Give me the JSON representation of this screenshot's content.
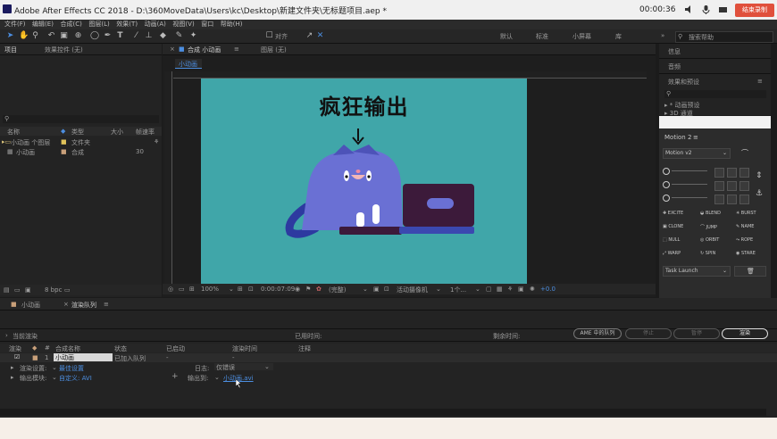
{
  "window": {
    "title": "Adobe After Effects CC 2018 - D:\\360MoveData\\Users\\kc\\Desktop\\新建文件夹\\无标题项目.aep *",
    "recording_time": "00:00:36",
    "recording_button": "结束录制"
  },
  "menu": [
    "文件(F)",
    "编辑(E)",
    "合成(C)",
    "图层(L)",
    "效果(T)",
    "动画(A)",
    "视图(V)",
    "窗口",
    "帮助(H)"
  ],
  "toolbar": {
    "snap_label": "对齐",
    "workspaces": [
      "默认",
      "标准",
      "小屏幕",
      "库"
    ],
    "search_placeholder": "搜索帮助"
  },
  "project_panel": {
    "tab_project": "项目",
    "tab_effects": "效果控件 (无)",
    "columns": [
      "名称",
      "类型",
      "大小",
      "帧速率"
    ],
    "items": [
      {
        "name": "小动画 个图层",
        "type": "文件夹",
        "size": ""
      },
      {
        "name": "小动画",
        "type": "合成",
        "size": "30"
      }
    ],
    "bpc": "8 bpc"
  },
  "composition_panel": {
    "tab_label": "合成 小动画",
    "layer_tab": "图层 (无)",
    "breadcrumb": "小动画",
    "canvas_title": "疯狂输出",
    "zoom": "100%",
    "timecode": "0:00:07:09",
    "resolution": "(完整)",
    "camera": "活动摄像机",
    "views": "1个...",
    "exposure": "+0.0"
  },
  "right_panels": {
    "info": "信息",
    "audio": "音频",
    "effects_presets": "效果和预设",
    "presets_item1": "▸ * 动画预设",
    "presets_item2": "▸ 3D 通道"
  },
  "motion_panel": {
    "title": "Motion 2",
    "version": "Motion v2",
    "buttons": [
      "EXCITE",
      "BLEND",
      "BURST",
      "CLONE",
      "JUMP",
      "NAME",
      "NULL",
      "ORBIT",
      "ROPE",
      "WARP",
      "SPIN",
      "STARE"
    ],
    "task": "Task Launch"
  },
  "bottom_tabs": {
    "tab1": "小动画",
    "tab2": "渲染队列"
  },
  "render_queue": {
    "current_render": "当前渲染",
    "elapsed_label": "已用时间:",
    "remaining_label": "剩余时间:",
    "ame_button": "AME 中的队列",
    "stop_button": "停止",
    "pause_button": "暂停",
    "render_button": "渲染",
    "columns": [
      "渲染",
      "#",
      "合成名称",
      "状态",
      "已启动",
      "渲染时间",
      "注释"
    ],
    "row": {
      "index": "1",
      "comp": "小动画",
      "status": "已加入队列",
      "started": "-",
      "render_time": "-"
    },
    "render_settings_label": "渲染设置:",
    "render_settings_value": "最佳设置",
    "output_module_label": "输出模块:",
    "output_module_value": "自定义: AVI",
    "log_label": "日志:",
    "log_value": "仅错误",
    "output_to_label": "输出到:",
    "output_to_value": "小动画.avi"
  }
}
